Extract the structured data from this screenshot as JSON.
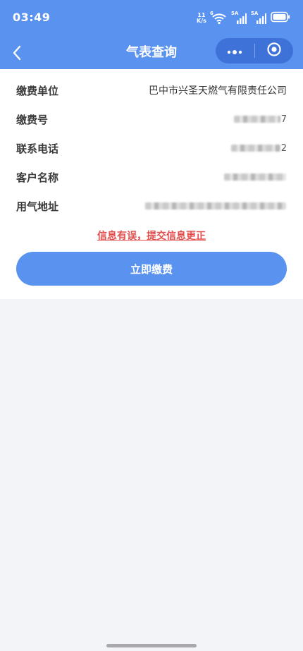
{
  "status_bar": {
    "time": "03:49",
    "net_speed_value": "11",
    "net_speed_unit": "K/s",
    "signal_1_label": "5A",
    "signal_2_label": "5A",
    "wifi_badge": "6",
    "icons": [
      "wifi-icon",
      "signal-icon",
      "signal-icon",
      "battery-icon"
    ]
  },
  "nav": {
    "title": "气表查询",
    "back_icon": "chevron-left-icon",
    "more_icon": "more-dots-icon",
    "close_icon": "target-icon"
  },
  "info": {
    "unit": {
      "label": "缴费单位",
      "value": "巴中市兴圣天燃气有限责任公司"
    },
    "account_no": {
      "label": "缴费号",
      "value_tail": "7"
    },
    "phone": {
      "label": "联系电话",
      "value_tail": "2"
    },
    "customer_name": {
      "label": "客户名称",
      "value_tail": ""
    },
    "address": {
      "label": "用气地址",
      "value_tail": ""
    }
  },
  "error_link": "信息有误，提交信息更正",
  "pay_button": "立即缴费",
  "colors": {
    "primary": "#5a92ef",
    "capsule": "#3f72d8",
    "error": "#e24d4d",
    "background": "#f3f4f8"
  }
}
